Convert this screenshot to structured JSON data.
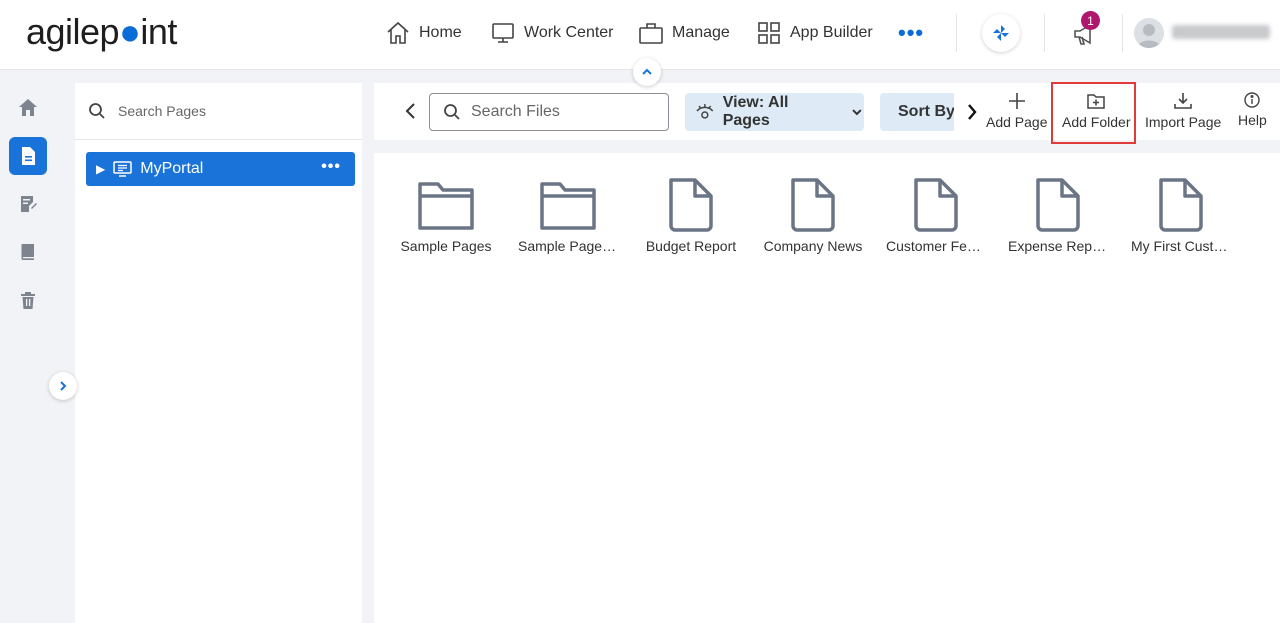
{
  "app": {
    "logo_text_a": "agilep",
    "logo_text_b": "int"
  },
  "topnav": {
    "items": [
      {
        "label": "Home",
        "icon": "home-icon"
      },
      {
        "label": "Work Center",
        "icon": "monitor-icon"
      },
      {
        "label": "Manage",
        "icon": "briefcase-icon"
      },
      {
        "label": "App Builder",
        "icon": "grid-icon"
      }
    ],
    "more_label": "•••",
    "notification_count": "1"
  },
  "rail": {
    "items": [
      "home-icon",
      "page-icon",
      "form-icon",
      "book-icon",
      "trash-icon"
    ],
    "active": "page-icon"
  },
  "pages_panel": {
    "search_placeholder": "Search Pages",
    "tree": [
      {
        "label": "MyPortal",
        "more": "•••"
      }
    ]
  },
  "toolbar": {
    "search_placeholder": "Search Files",
    "view_label": "View: All Pages",
    "sort_label": "Sort By",
    "actions": [
      {
        "label": "Add Page",
        "icon": "plus-icon"
      },
      {
        "label": "Add Folder",
        "icon": "add-folder-icon"
      },
      {
        "label": "Import Page",
        "icon": "download-icon"
      },
      {
        "label": "Help",
        "icon": "info-icon"
      }
    ]
  },
  "files": [
    {
      "label": "Sample Pages",
      "type": "folder"
    },
    {
      "label": "Sample Pages Folder",
      "type": "folder"
    },
    {
      "label": "Budget Report",
      "type": "file"
    },
    {
      "label": "Company News",
      "type": "file"
    },
    {
      "label": "Customer Feedback",
      "type": "file"
    },
    {
      "label": "Expense Report",
      "type": "file"
    },
    {
      "label": "My First Custom Page",
      "type": "file"
    }
  ],
  "colors": {
    "accent": "#1a73d9",
    "highlight": "#e03a3a",
    "badge": "#b0166d",
    "view_bg": "#deebf7"
  }
}
